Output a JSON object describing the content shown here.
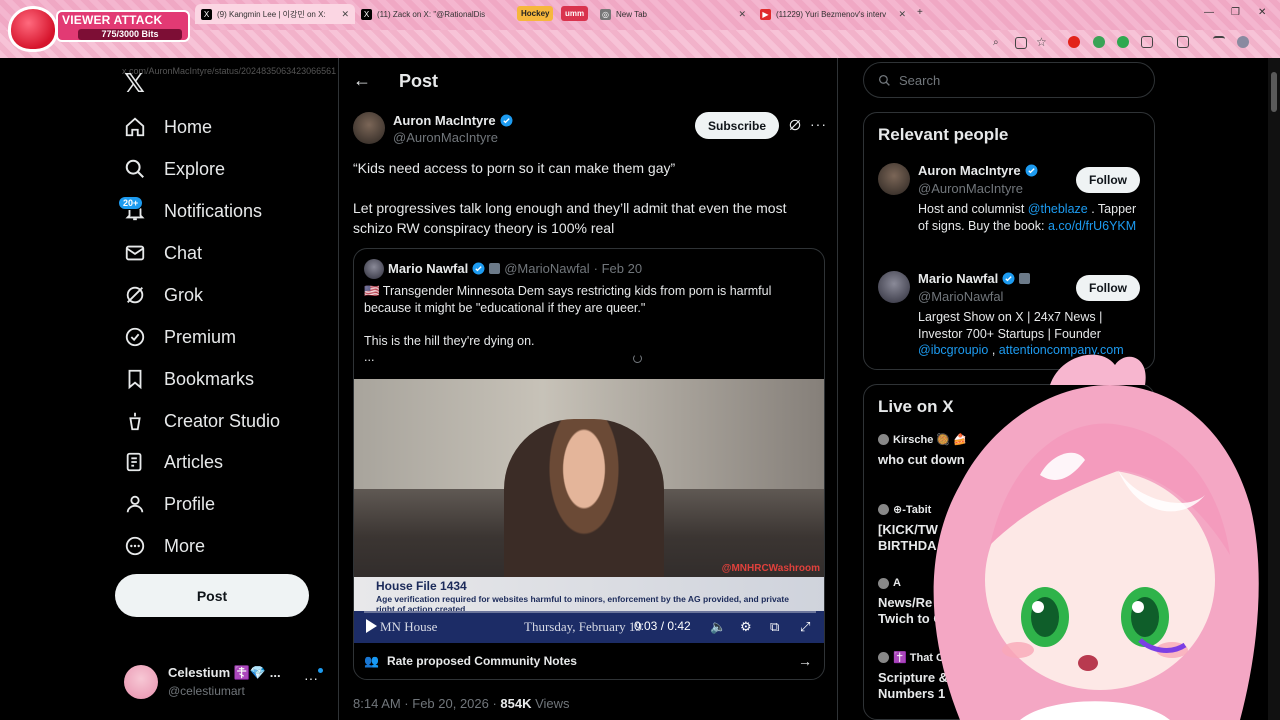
{
  "browser": {
    "tabs": [
      {
        "label": "(9) Kangmin Lee | 이강민 on X: ",
        "fav": "X"
      },
      {
        "label": "(11) Zack on X: \"@RationalDis",
        "fav": "X"
      },
      {
        "label": "New Tab",
        "fav": "◎"
      },
      {
        "label": "(11229) Yuri Bezmenov's interv",
        "fav": "▶"
      }
    ],
    "pills": [
      "Hockey",
      "umm"
    ],
    "url": "x.com/AuronMacIntyre/status/2024835063423066561"
  },
  "overlay": {
    "title": "VIEWER ATTACK",
    "progress_text": "775/3000 Bits",
    "progress_fraction": 0.258
  },
  "nav": {
    "items": [
      {
        "label": "Home",
        "icon": "home-icon"
      },
      {
        "label": "Explore",
        "icon": "search-icon"
      },
      {
        "label": "Notifications",
        "icon": "bell-icon"
      },
      {
        "label": "Chat",
        "icon": "mail-icon"
      },
      {
        "label": "Grok",
        "icon": "grok-icon"
      },
      {
        "label": "Premium",
        "icon": "premium-icon"
      },
      {
        "label": "Bookmarks",
        "icon": "bookmark-icon"
      },
      {
        "label": "Creator Studio",
        "icon": "creator-icon"
      },
      {
        "label": "Articles",
        "icon": "articles-icon"
      },
      {
        "label": "Profile",
        "icon": "person-icon"
      },
      {
        "label": "More",
        "icon": "more-icon"
      }
    ],
    "notif_badge": "20+",
    "post_label": "Post",
    "account": {
      "name": "Celestium ☦️💎 ...",
      "handle": "@celestiumart"
    }
  },
  "post": {
    "header": "Post",
    "author": {
      "name": "Auron MacIntyre",
      "handle": "@AuronMacIntyre"
    },
    "subscribe_label": "Subscribe",
    "text_line1": "“Kids need access to porn so it can make them gay”",
    "text_line2": "Let progressives talk long enough and they’ll admit that even the most schizo RW conspiracy theory is 100% real",
    "quote": {
      "name": "Mario Nawfal",
      "handle": "@MarioNawfal",
      "date": "· Feb 20",
      "text1": "🇺🇸 Transgender Minnesota Dem says restricting kids from porn is harmful because it might be \"educational if they are queer.\"",
      "text2": "This is the hill they're dying on.",
      "ellipsis": "...",
      "video": {
        "lower_title": "House File 1434",
        "lower_sub": "Age verification required for websites harmful to minors, enforcement by the AG provided, and private right of action created",
        "watermark": "@MNHRCWashroom",
        "channel": "MN House",
        "date": "Thursday, February 19",
        "time": "0:03 / 0:42"
      },
      "notes_label": "Rate proposed Community Notes"
    },
    "meta_time": "8:14 AM · Feb 20, 2026 · ",
    "views_count": "854K",
    "views_label": " Views"
  },
  "sidebar": {
    "search_placeholder": "Search",
    "relevant_title": "Relevant people",
    "people": [
      {
        "name": "Auron MacIntyre",
        "handle": "@AuronMacIntyre",
        "bio_pre": "Host and columnist ",
        "bio_link": "@theblaze",
        "bio_mid": " . Tapper of signs. Buy the book: ",
        "bio_link2": "a.co/d/frU6YKM",
        "follow": "Follow"
      },
      {
        "name": "Mario Nawfal",
        "handle": "@MarioNawfal",
        "bio_pre": "Largest Show on X | 24x7 News | Investor 700+ Startups | Founder ",
        "bio_link": "@ibcgroupio",
        "bio_mid": " , ",
        "bio_link2": "attentioncompany.com",
        "follow": "Follow"
      }
    ],
    "live_title": "Live on X",
    "live": [
      {
        "host": "Kirsche 🥘 🍰",
        "title": "who cut down"
      },
      {
        "host": "⊕-Tabit",
        "title": "[KICK/TW BIRTHDA"
      },
      {
        "host": "A",
        "title": "News/Re Twich to Ch"
      },
      {
        "host": "✝️ That Ca",
        "title": "Scripture & Numbers 1"
      }
    ]
  }
}
